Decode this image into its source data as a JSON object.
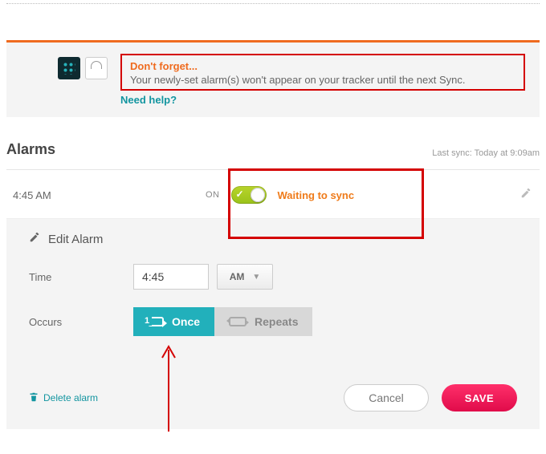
{
  "notice": {
    "headline": "Don't forget...",
    "sub": "Your newly-set alarm(s) won't appear on your tracker until the next Sync.",
    "help": "Need help?"
  },
  "section": {
    "title": "Alarms",
    "last_sync": "Last sync: Today at 9:09am"
  },
  "alarm": {
    "time_display": "4:45 AM",
    "state_label": "ON",
    "sync_status": "Waiting to sync"
  },
  "edit": {
    "header": "Edit Alarm",
    "time_label": "Time",
    "time_value": "4:45",
    "ampm": "AM",
    "occurs_label": "Occurs",
    "once_label": "Once",
    "repeats_label": "Repeats",
    "delete_label": "Delete alarm",
    "cancel_label": "Cancel",
    "save_label": "SAVE"
  }
}
